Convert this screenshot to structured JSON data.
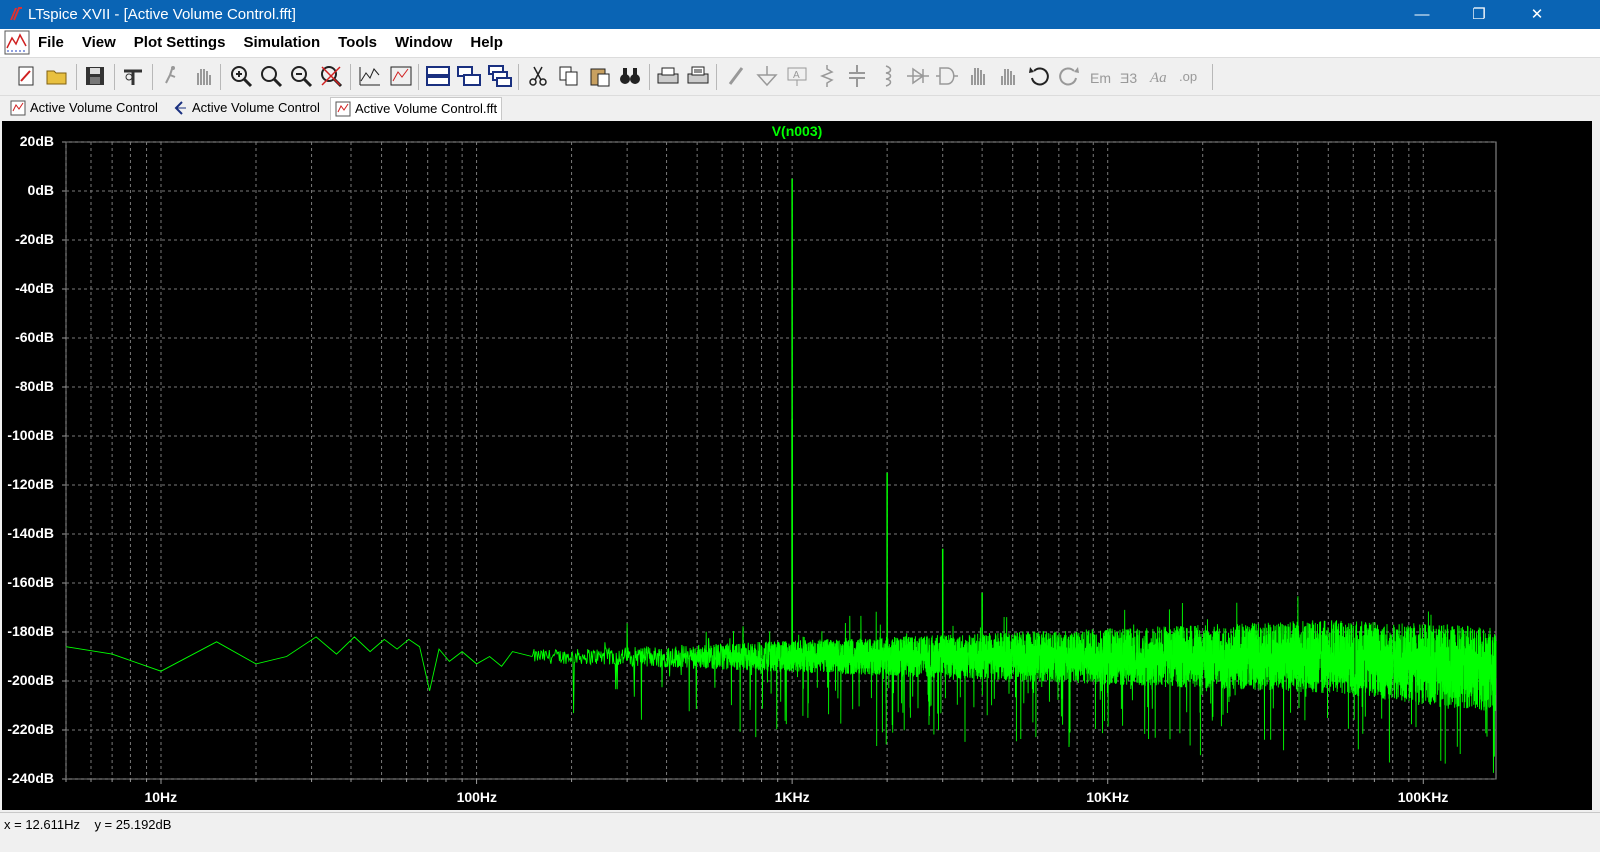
{
  "window": {
    "title": "LTspice XVII - [Active Volume Control.fft]",
    "minimize_glyph": "—",
    "restore_glyph": "❐",
    "close_glyph": "✕"
  },
  "menu": {
    "items": [
      "File",
      "View",
      "Plot Settings",
      "Simulation",
      "Tools",
      "Window",
      "Help"
    ],
    "mdi_minimize": "–",
    "mdi_restore": "⧉",
    "mdi_close": "✕"
  },
  "toolbar": {
    "icons": [
      "new-schematic-icon",
      "open-icon",
      "save-icon",
      "control-panel-icon",
      "run-icon",
      "halt-icon",
      "zoom-area-icon",
      "zoom-in-icon",
      "zoom-out-icon",
      "zoom-fit-icon",
      "autorange-icon",
      "plot-area-icon",
      "tile-horizontal-icon",
      "tile-vertical-icon",
      "cascade-icon",
      "cut-icon",
      "copy-icon",
      "paste-icon",
      "find-icon",
      "print-icon",
      "print-preview-icon",
      "wire-icon",
      "ground-icon",
      "label-icon",
      "resistor-icon",
      "capacitor-icon",
      "inductor-icon",
      "diode-icon",
      "component-icon",
      "move-icon",
      "drag-icon",
      "undo-icon",
      "redo-icon",
      "rotate-icon",
      "mirror-icon",
      "text-icon",
      "spice-directive-icon"
    ]
  },
  "tabs": [
    {
      "label": "Active Volume Control",
      "icon": "schematic-icon",
      "active": false
    },
    {
      "label": "Active Volume Control",
      "icon": "netlist-icon",
      "active": false
    },
    {
      "label": "Active Volume Control.fft",
      "icon": "waveform-icon",
      "active": true
    }
  ],
  "status": {
    "cursor_readout": "x = 12.611Hz    y = 25.192dB"
  },
  "chart_data": {
    "type": "line",
    "title": "V(n003)",
    "xscale": "log",
    "x_range_hz": [
      5,
      170000
    ],
    "ylim": [
      -240,
      20
    ],
    "y_ticks": [
      "20dB",
      "0dB",
      "-20dB",
      "-40dB",
      "-60dB",
      "-80dB",
      "-100dB",
      "-120dB",
      "-140dB",
      "-160dB",
      "-180dB",
      "-200dB",
      "-220dB",
      "-240dB"
    ],
    "y_tick_values": [
      20,
      0,
      -20,
      -40,
      -60,
      -80,
      -100,
      -120,
      -140,
      -160,
      -180,
      -200,
      -220,
      -240
    ],
    "x_ticks": [
      "10Hz",
      "100Hz",
      "1KHz",
      "10KHz",
      "100KHz"
    ],
    "x_tick_values": [
      10,
      100,
      1000,
      10000,
      100000
    ],
    "grid": true,
    "trace_color": "#00ff00",
    "background": "#000000",
    "series": [
      {
        "name": "V(n003)",
        "low_freq_points": [
          [
            5,
            -186
          ],
          [
            7,
            -189
          ],
          [
            10,
            -196
          ],
          [
            15,
            -184
          ],
          [
            20,
            -193
          ],
          [
            25,
            -190
          ],
          [
            31,
            -182
          ],
          [
            36,
            -189
          ],
          [
            41,
            -182
          ],
          [
            46,
            -188
          ],
          [
            51,
            -183
          ],
          [
            56,
            -187
          ],
          [
            61,
            -183
          ],
          [
            66,
            -186
          ],
          [
            71,
            -204
          ],
          [
            76,
            -187
          ],
          [
            82,
            -192
          ],
          [
            90,
            -188
          ],
          [
            100,
            -193
          ],
          [
            110,
            -190
          ],
          [
            120,
            -194
          ],
          [
            130,
            -188
          ],
          [
            150,
            -190
          ]
        ],
        "peaks": [
          {
            "freq": 1000,
            "db": 5
          },
          {
            "freq": 1000,
            "db": -93
          },
          {
            "freq": 2000,
            "db": -115
          },
          {
            "freq": 3000,
            "db": -146
          },
          {
            "freq": 4000,
            "db": -164
          }
        ],
        "noise_floor_db": -190
      }
    ]
  }
}
